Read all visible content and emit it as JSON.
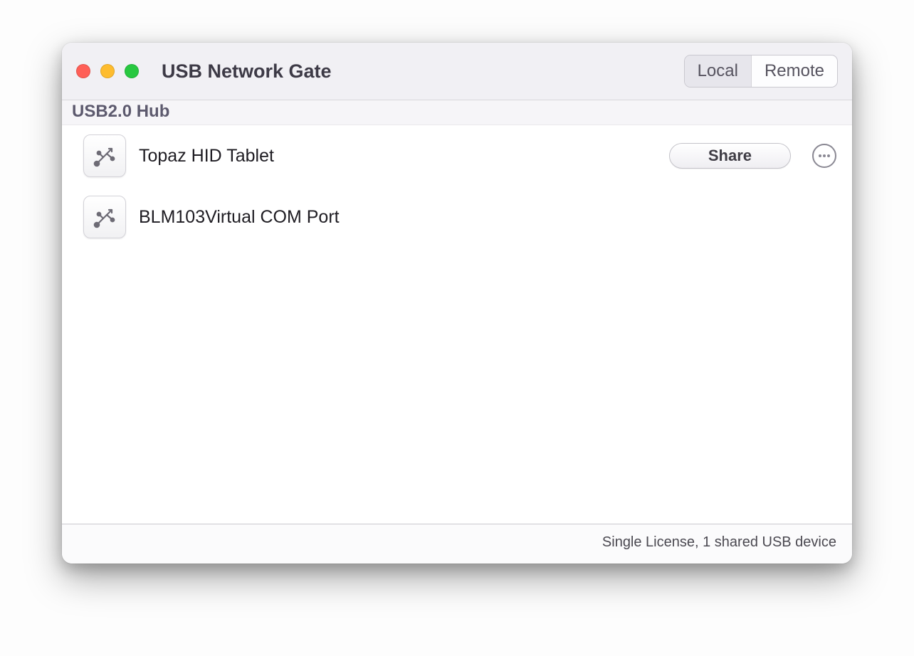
{
  "window": {
    "title": "USB Network Gate"
  },
  "tabs": {
    "local": "Local",
    "remote": "Remote",
    "active": "local"
  },
  "section_header": "USB2.0 Hub",
  "devices": [
    {
      "name": "Topaz HID Tablet",
      "share_label": "Share",
      "shared": true
    },
    {
      "name": "BLM103Virtual COM Port",
      "shared": false
    }
  ],
  "status": "Single License, 1 shared USB device"
}
